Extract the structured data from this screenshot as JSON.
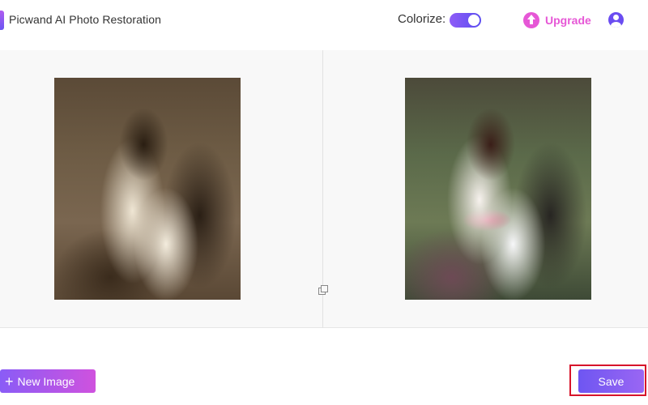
{
  "header": {
    "app_title": "Picwand AI Photo Restoration",
    "colorize_label": "Colorize:",
    "colorize_enabled": true,
    "upgrade_label": "Upgrade"
  },
  "icons": {
    "logo": "brand-logo",
    "upgrade": "upgrade-icon",
    "user": "user-icon",
    "compare": "compare-icon",
    "plus": "plus-icon"
  },
  "footer": {
    "new_image_label": "New Image",
    "new_image_icon": "+",
    "save_label": "Save"
  },
  "colors": {
    "accent_purple": "#6a55f2",
    "accent_pink": "#e657d6",
    "highlight_red": "#d7142b"
  }
}
